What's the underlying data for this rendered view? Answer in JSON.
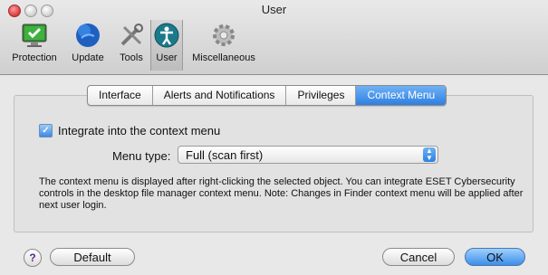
{
  "window": {
    "title": "User"
  },
  "toolbar": {
    "items": [
      {
        "label": "Protection",
        "icon": "monitor-check-icon"
      },
      {
        "label": "Update",
        "icon": "globe-icon"
      },
      {
        "label": "Tools",
        "icon": "tools-icon"
      },
      {
        "label": "User",
        "icon": "user-icon"
      },
      {
        "label": "Miscellaneous",
        "icon": "gear-icon"
      }
    ]
  },
  "tabs": {
    "items": [
      {
        "label": "Interface"
      },
      {
        "label": "Alerts and Notifications"
      },
      {
        "label": "Privileges"
      },
      {
        "label": "Context Menu"
      }
    ],
    "selected": "Context Menu"
  },
  "context_menu": {
    "integrate_label": "Integrate into the context menu",
    "integrate_checked": true,
    "menu_type_label": "Menu type:",
    "menu_type_value": "Full (scan first)",
    "description": "The context menu is displayed after right-clicking the selected object. You can integrate ESET Cybersecurity controls in the desktop file manager context menu. Note: Changes in Finder context menu will be applied after next user login."
  },
  "buttons": {
    "help": "?",
    "default": "Default",
    "cancel": "Cancel",
    "ok": "OK"
  }
}
